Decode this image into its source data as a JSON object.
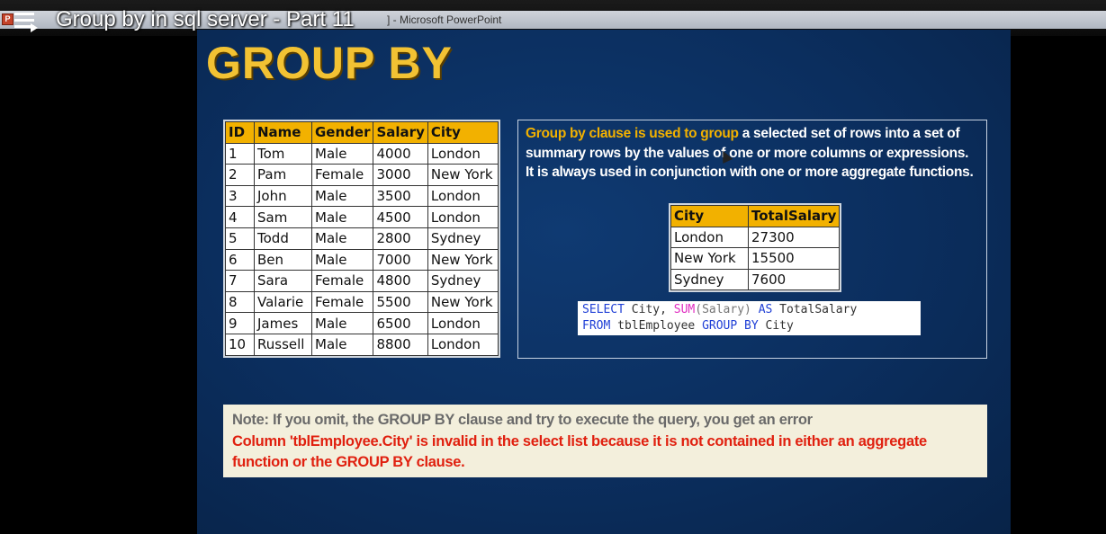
{
  "window": {
    "app_icon": "P",
    "caption": "] - Microsoft PowerPoint"
  },
  "video": {
    "title": "Group by in sql server - Part 11"
  },
  "slide": {
    "title": "GROUP BY",
    "employee_table": {
      "headers": [
        "ID",
        "Name",
        "Gender",
        "Salary",
        "City"
      ],
      "rows": [
        [
          "1",
          "Tom",
          "Male",
          "4000",
          "London"
        ],
        [
          "2",
          "Pam",
          "Female",
          "3000",
          "New York"
        ],
        [
          "3",
          "John",
          "Male",
          "3500",
          "London"
        ],
        [
          "4",
          "Sam",
          "Male",
          "4500",
          "London"
        ],
        [
          "5",
          "Todd",
          "Male",
          "2800",
          "Sydney"
        ],
        [
          "6",
          "Ben",
          "Male",
          "7000",
          "New York"
        ],
        [
          "7",
          "Sara",
          "Female",
          "4800",
          "Sydney"
        ],
        [
          "8",
          "Valarie",
          "Female",
          "5500",
          "New York"
        ],
        [
          "9",
          "James",
          "Male",
          "6500",
          "London"
        ],
        [
          "10",
          "Russell",
          "Male",
          "8800",
          "London"
        ]
      ]
    },
    "description": {
      "highlight": "Group by clause is used to group",
      "rest": " a selected set of rows into a set of summary rows by the values of one or more columns or expressions. It is always used in conjunction with one or more aggregate functions."
    },
    "summary_table": {
      "headers": [
        "City",
        "TotalSalary"
      ],
      "rows": [
        [
          "London",
          "27300"
        ],
        [
          "New York",
          "15500"
        ],
        [
          "Sydney",
          "7600"
        ]
      ]
    },
    "sql": {
      "line1": [
        "SELECT",
        " City, ",
        "SUM",
        "(Salary) ",
        "AS",
        " TotalSalary"
      ],
      "line2": [
        "FROM",
        " tblEmployee ",
        "GROUP BY",
        " City"
      ]
    },
    "note": {
      "line1": "Note: If you omit, the GROUP BY clause and try to execute the query, you get an error",
      "line2": "Column 'tblEmployee.City' is invalid in the select list because it is not contained in either an aggregate function or the GROUP BY clause."
    }
  },
  "colors": {
    "slide_bg": "#0b2e5e",
    "title": "#f2c233",
    "table_header": "#f2b100",
    "note_bg": "#f3efdc",
    "error_red": "#e0200f",
    "sql_keyword": "#1f3fd6",
    "sql_function": "#e02cc0"
  }
}
